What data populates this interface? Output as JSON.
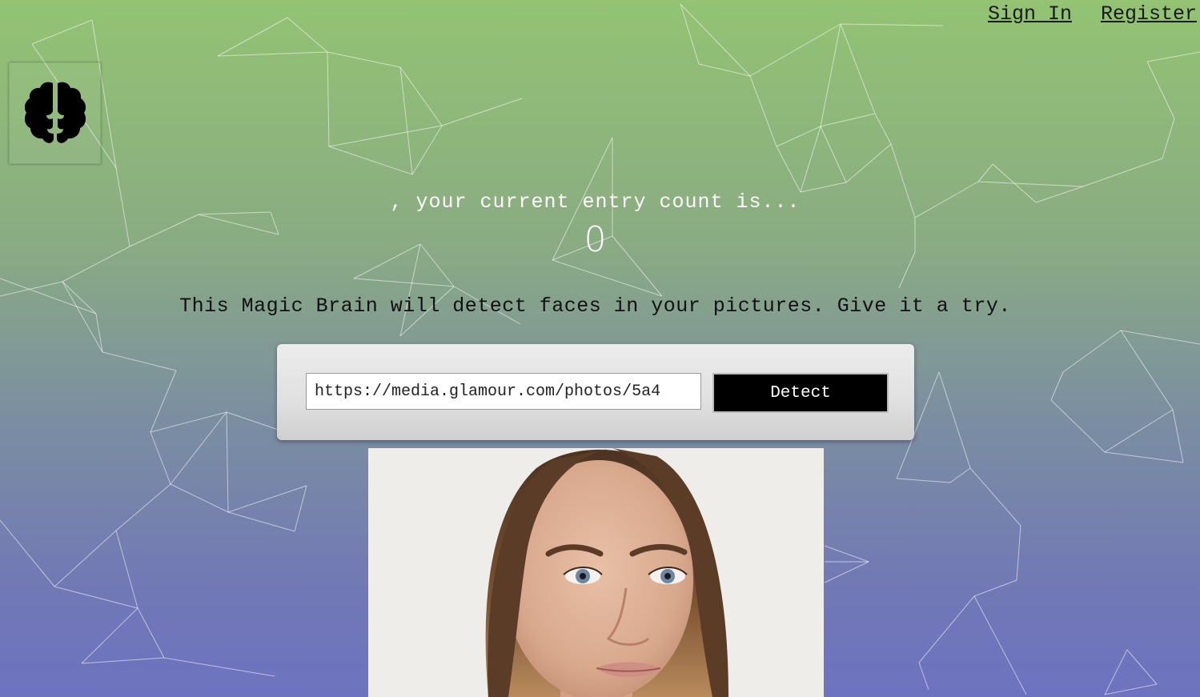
{
  "nav": {
    "sign_in": "Sign In",
    "register": "Register"
  },
  "logo": {
    "icon": "brain-icon"
  },
  "rank": {
    "message": ", your current entry count is...",
    "count": "0"
  },
  "intro": {
    "text": "This Magic Brain will detect faces in your pictures. Give it a try."
  },
  "form": {
    "url_value": "https://media.glamour.com/photos/5a4",
    "detect_label": "Detect"
  },
  "image": {
    "subject": "portrait-photo"
  },
  "colors": {
    "gradient_top": "#93c373",
    "gradient_bottom": "#6d73bf",
    "button_bg": "#000000"
  }
}
